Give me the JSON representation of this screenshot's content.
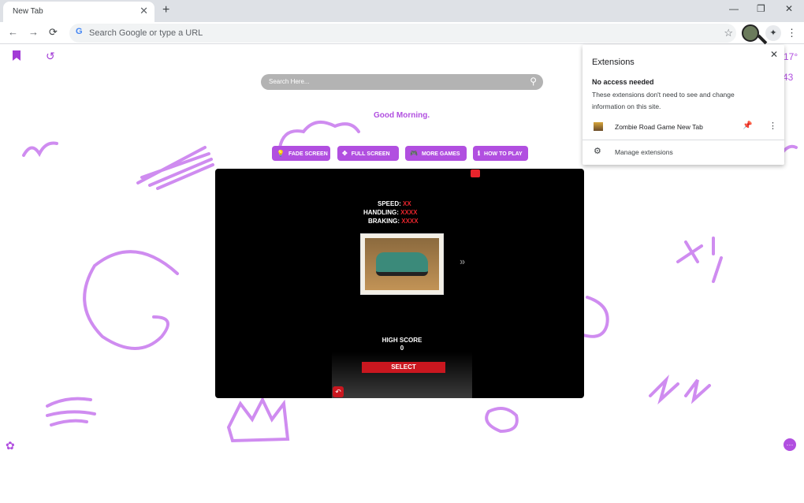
{
  "browser": {
    "tab_title": "New Tab",
    "tab_close": "✕",
    "new_tab": "+",
    "minimize": "—",
    "restore": "❐",
    "close": "✕",
    "back": "←",
    "forward": "→",
    "reload": "⟳",
    "omnibox_icon": "G",
    "omnibox_placeholder": "Search Google or type a URL",
    "bookmark_star": "☆",
    "extensions_button": "✦",
    "menu": "⋮"
  },
  "page": {
    "search_placeholder": "Search Here...",
    "search_icon": "⚲",
    "greeting": "Good Morning.",
    "weather_temp": "17°",
    "weather_extra": "43",
    "bookmarks_icon": "bookmark",
    "history_icon": "⟲",
    "history_glyph": "↺",
    "settings_glyph": "✿",
    "more_glyph": "⋯",
    "accent_color": "#b14fe0",
    "buttons": [
      {
        "icon": "💡",
        "label": "FADE SCREEN"
      },
      {
        "icon": "✥",
        "label": "FULL SCREEN"
      },
      {
        "icon": "🎮",
        "label": "MORE GAMES"
      },
      {
        "icon": "ℹ",
        "label": "HOW TO PLAY"
      }
    ]
  },
  "game": {
    "stats": [
      {
        "label": "SPEED:",
        "value": "XX"
      },
      {
        "label": "HANDLING:",
        "value": "XXXX"
      },
      {
        "label": "BRAKING:",
        "value": "XXXX"
      }
    ],
    "next_arrow": "»",
    "high_score_label": "HIGH SCORE",
    "high_score_value": "0",
    "select_label": "SELECT",
    "back_glyph": "↶"
  },
  "extensions_popup": {
    "title": "Extensions",
    "close": "✕",
    "section_heading": "No access needed",
    "section_desc": "These extensions don't need to see and change information on this site.",
    "extension_name": "Zombie Road Game New Tab",
    "pin_glyph": "📌",
    "more_glyph": "⋮",
    "manage_glyph": "⚙",
    "manage_label": "Manage extensions"
  }
}
